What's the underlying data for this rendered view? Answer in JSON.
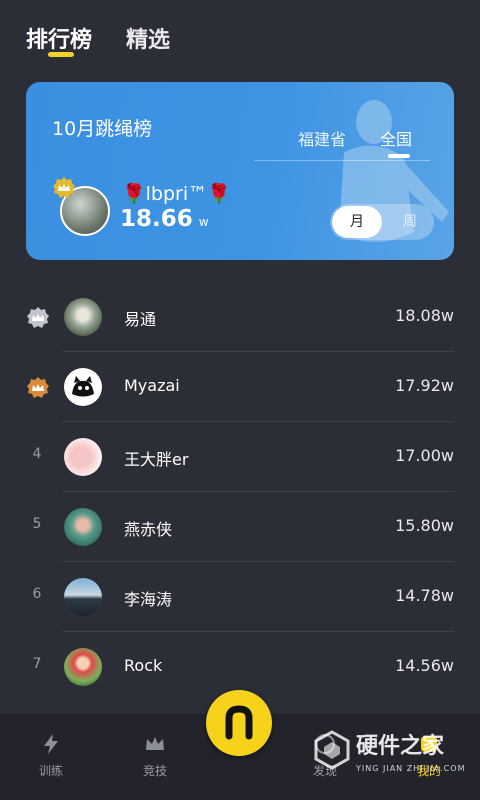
{
  "top_tabs": [
    {
      "label": "排行榜",
      "active": true
    },
    {
      "label": "精选",
      "active": false
    }
  ],
  "hero": {
    "title": "10月跳绳榜",
    "regions": [
      "福建省",
      "全国"
    ],
    "active_region": "全国",
    "user_name": "🌹lbpri™🌹",
    "score": "18.66",
    "unit": "w",
    "period_options": [
      "月",
      "周"
    ],
    "active_period": "月"
  },
  "leaderboard": [
    {
      "rank": "",
      "badge": "silver-crown-icon",
      "name": "易通",
      "score": "18.08w"
    },
    {
      "rank": "",
      "badge": "bronze-crown-icon",
      "name": "Myazai",
      "score": "17.92w"
    },
    {
      "rank": "4",
      "badge": "",
      "name": "王大胖er",
      "score": "17.00w"
    },
    {
      "rank": "5",
      "badge": "",
      "name": "燕赤侠",
      "score": "15.80w"
    },
    {
      "rank": "6",
      "badge": "",
      "name": "李海涛",
      "score": "14.78w"
    },
    {
      "rank": "7",
      "badge": "",
      "name": "Rock",
      "score": "14.56w"
    }
  ],
  "bottom_nav": [
    {
      "label": "训练",
      "icon": "lightning-icon"
    },
    {
      "label": "竞技",
      "icon": "crown-icon"
    },
    {
      "label": "发现",
      "icon": "compass-icon"
    },
    {
      "label": "我的",
      "icon": "person-icon"
    }
  ],
  "watermark": {
    "text": "硬件之家",
    "sub": "YING JIAN ZHI JIA.COM"
  },
  "colors": {
    "accent": "#f6d21b",
    "hero_blue": "#3e93e3",
    "background": "#2b2d37"
  }
}
